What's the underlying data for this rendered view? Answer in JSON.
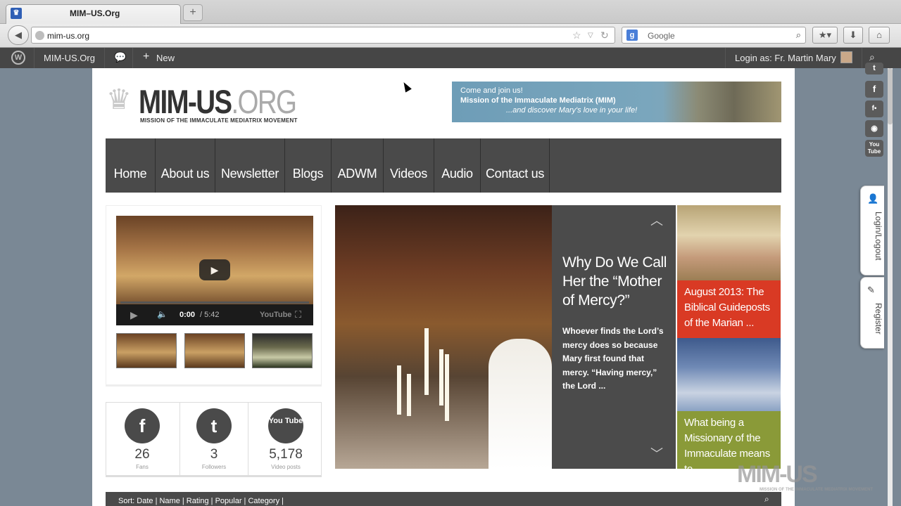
{
  "browser": {
    "tab_title": "MIM–US.Org",
    "new_tab": "+",
    "url": "mim-us.org",
    "search_placeholder": "Google"
  },
  "wpbar": {
    "site_name": "MIM-US.Org",
    "new_label": "New",
    "login": "Login as: Fr. Martin Mary"
  },
  "header": {
    "logo_main": "MIM-US",
    "logo_org": ".ORG",
    "logo_sub": "MISSION OF THE IMMACULATE MEDIATRIX MOVEMENT",
    "banner_line1": "Come and join us!",
    "banner_line2": "Mission of the Immaculate Mediatrix (MIM)",
    "banner_line3": "...and discover Mary's love in your life!"
  },
  "nav": [
    "Home",
    "About us",
    "Newsletter",
    "Blogs",
    "ADWM",
    "Videos",
    "Audio",
    "Contact us"
  ],
  "video": {
    "time": "0:00",
    "duration": "/ 5:42",
    "brand": "YouTube"
  },
  "stats": [
    {
      "icon": "f",
      "value": "26",
      "label": "Fans"
    },
    {
      "icon": "t",
      "value": "3",
      "label": "Followers"
    },
    {
      "icon": "You Tube",
      "value": "5,178",
      "label": "Video posts"
    }
  ],
  "slider": {
    "heading": "Why Do We Call Her the “Mother of Mercy?”",
    "excerpt": "Whoever finds the Lord’s mercy does so because Mary first found that mercy. “Having mercy,” the Lord ..."
  },
  "side_posts": [
    {
      "title": "August 2013: The Biblical Guideposts of the Marian ...",
      "color": "#d93a24"
    },
    {
      "title": "What being a Missionary of the Immaculate means to",
      "color": "#8a9a38"
    }
  ],
  "sortbar": "Sort: Date | Name | Rating | Popular | Category |",
  "floating": {
    "login_tab": "Login/Logout",
    "register_tab": "Register"
  },
  "watermark": {
    "main": "MIM-US",
    "sub": "MISSION OF THE IMMACULATE MEDIATRIX MOVEMENT"
  }
}
